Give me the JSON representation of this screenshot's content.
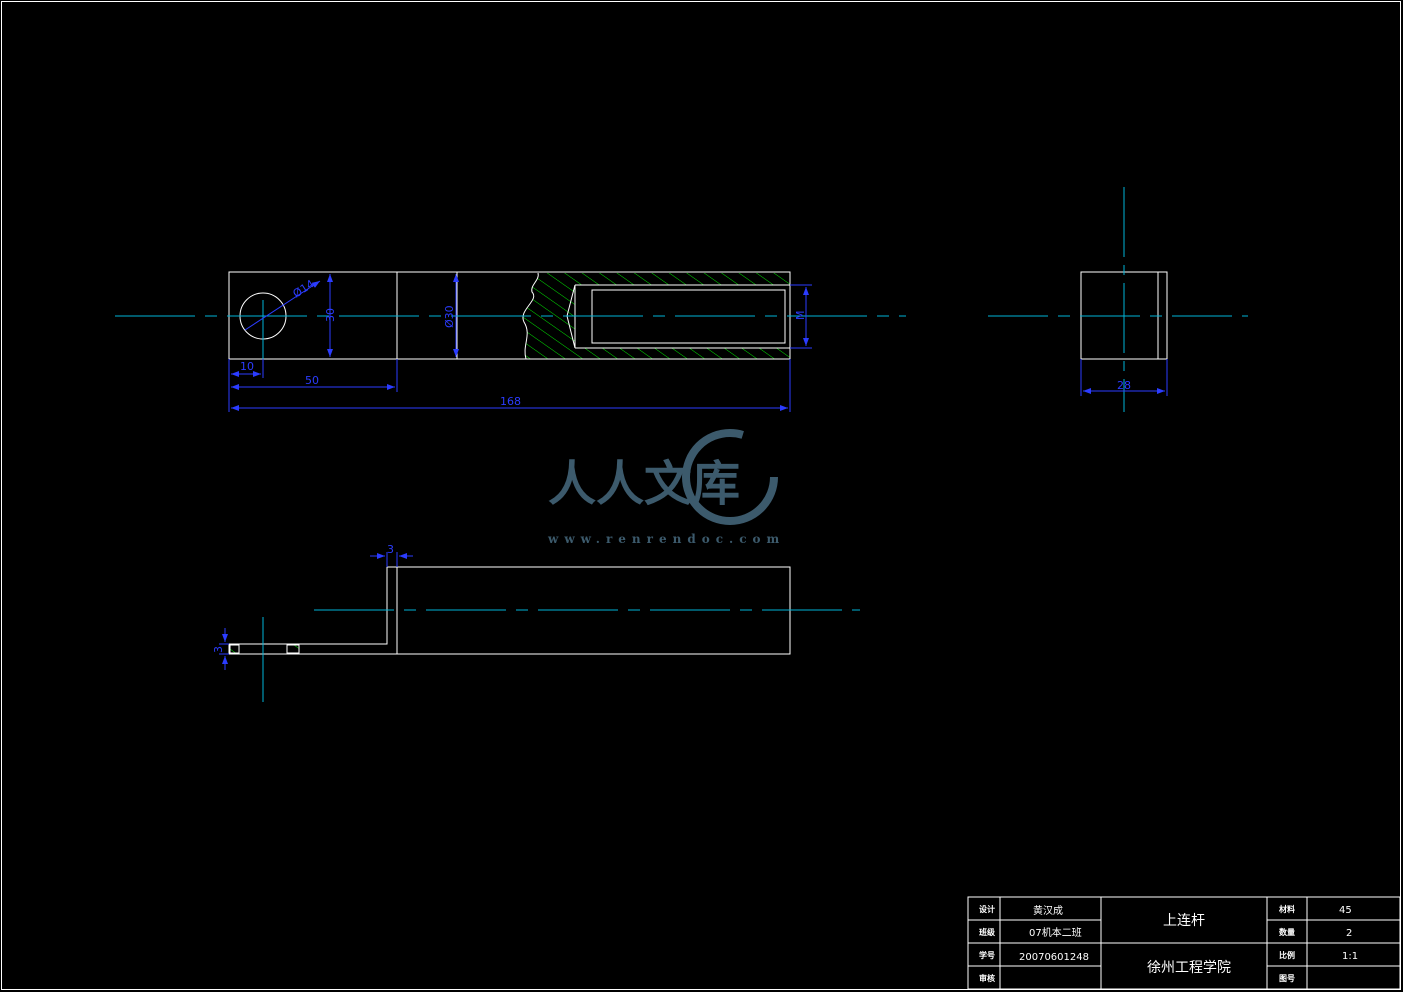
{
  "drawing": {
    "front_view": {
      "dim_hole": "Ø14",
      "dim_height_left": "30",
      "dim_height_mid": "Ø30",
      "dim_thread": "M",
      "dim_10": "10",
      "dim_50": "50",
      "dim_total": "168"
    },
    "side_view": {
      "dim_width": "28"
    },
    "bottom_view": {
      "dim_thickness_top": "3",
      "dim_thickness_left": "3"
    }
  },
  "watermark": {
    "text_cn": "人人文库",
    "url": "www.renrendoc.com"
  },
  "title_block": {
    "designer_label": "设计",
    "designer_value": "黄汉成",
    "class_label": "班级",
    "class_value": "07机本二班",
    "id_label": "学号",
    "id_value": "20070601248",
    "review_label": "审核",
    "review_value": "",
    "part_name": "上连杆",
    "school": "徐州工程学院",
    "material_label": "材料",
    "material_value": "45",
    "quantity_label": "数量",
    "quantity_value": "2",
    "scale_label": "比例",
    "scale_value": "1:1",
    "drawing_no_label": "图号",
    "drawing_no_value": ""
  }
}
